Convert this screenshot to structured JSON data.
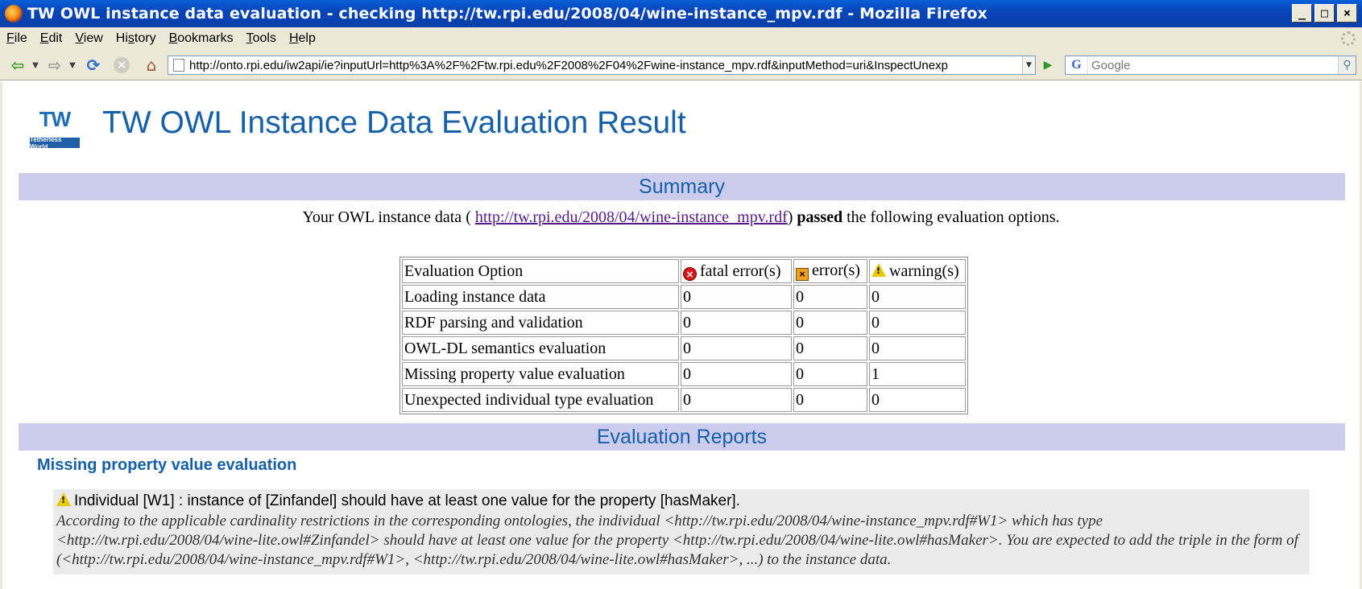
{
  "window": {
    "title": "TW OWL instance data evaluation - checking http://tw.rpi.edu/2008/04/wine-instance_mpv.rdf - Mozilla Firefox",
    "minimize": "_",
    "maximize": "□",
    "close": "×"
  },
  "menu": [
    {
      "accel": "F",
      "rest": "ile"
    },
    {
      "accel": "E",
      "rest": "dit"
    },
    {
      "accel": "V",
      "rest": "iew"
    },
    {
      "accel": "",
      "pre": "Hi",
      "accel2": "s",
      "rest": "tory"
    },
    {
      "accel": "B",
      "rest": "ookmarks"
    },
    {
      "accel": "T",
      "rest": "ools"
    },
    {
      "accel": "H",
      "rest": "elp"
    }
  ],
  "nav": {
    "url": "http://onto.rpi.edu/iw2api/ie?inputUrl=http%3A%2F%2Ftw.rpi.edu%2F2008%2F04%2Fwine-instance_mpv.rdf&inputMethod=uri&InspectUnexp",
    "search_placeholder": "Google",
    "icons": {
      "back": "back-arrow-icon",
      "forward": "forward-arrow-icon",
      "reload": "reload-icon",
      "stop": "stop-icon",
      "home": "home-icon",
      "go": "go-arrow-icon",
      "search_engine": "google-icon",
      "search": "magnifier-icon"
    }
  },
  "page": {
    "logo_text": "TW",
    "logo_caption": "Tetherless World",
    "title": "TW OWL Instance Data Evaluation Result",
    "summary_heading": "Summary",
    "summary": {
      "prefix": "Your OWL instance data (",
      "link": "http://tw.rpi.edu/2008/04/wine-instance_mpv.rdf",
      "close_paren": ")",
      "status": "passed",
      "suffix": "the following evaluation options."
    },
    "table": {
      "headers": [
        "Evaluation Option",
        "fatal error(s)",
        "error(s)",
        "warning(s)"
      ],
      "rows": [
        {
          "option": "Loading instance data",
          "fatal": "0",
          "error": "0",
          "warning": "0"
        },
        {
          "option": "RDF parsing and validation",
          "fatal": "0",
          "error": "0",
          "warning": "0"
        },
        {
          "option": "OWL-DL semantics evaluation",
          "fatal": "0",
          "error": "0",
          "warning": "0"
        },
        {
          "option": "Missing property value evaluation",
          "fatal": "0",
          "error": "0",
          "warning": "1"
        },
        {
          "option": "Unexpected individual type evaluation",
          "fatal": "0",
          "error": "0",
          "warning": "0"
        }
      ]
    },
    "reports_heading": "Evaluation Reports",
    "report": {
      "heading": "Missing property value evaluation",
      "message": "Individual [W1] : instance of [Zinfandel] should have at least one value for the property [hasMaker].",
      "detail": "According to the applicable cardinality restrictions in the corresponding ontologies, the individual <http://tw.rpi.edu/2008/04/wine-instance_mpv.rdf#W1> which has type <http://tw.rpi.edu/2008/04/wine-lite.owl#Zinfandel> should have at least one value for the property <http://tw.rpi.edu/2008/04/wine-lite.owl#hasMaker>. You are expected to add the triple in the form of (<http://tw.rpi.edu/2008/04/wine-instance_mpv.rdf#W1>, <http://tw.rpi.edu/2008/04/wine-lite.owl#hasMaker>, ...) to the instance data."
    }
  },
  "colors": {
    "titlebar": "#0845b8",
    "chrome": "#ece9d8",
    "section_bar": "#ccccee",
    "heading_blue": "#1560a8",
    "link": "#551a8b",
    "report_bg": "#ebebeb"
  }
}
